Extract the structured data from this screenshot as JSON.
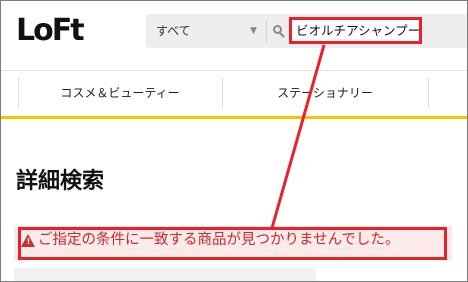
{
  "brand": {
    "logo_text": "LoFt"
  },
  "search": {
    "category": "すべて",
    "query": "ビオルチアシャンプー"
  },
  "nav": {
    "items": [
      {
        "label": "コスメ＆ビューティー"
      },
      {
        "label": "ステーショナリー"
      }
    ]
  },
  "main": {
    "title": "詳細検索",
    "alert_message": "ご指定の条件に一致する商品が見つかりませんでした。"
  },
  "colors": {
    "accent_yellow": "#f5c400",
    "highlight_red": "#e8212b",
    "alert_text": "#c8282e",
    "alert_bg": "#fbeaea"
  },
  "icons": [
    "search-icon",
    "chevron-down-icon",
    "warning-icon"
  ]
}
